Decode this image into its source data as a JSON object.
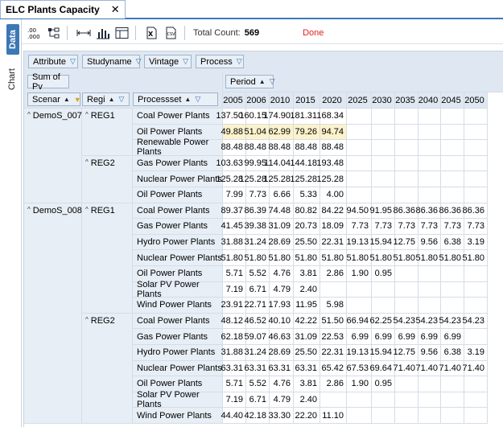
{
  "document_tab": {
    "title": "ELC Plants Capacity",
    "close": "✕"
  },
  "side_tabs": [
    {
      "label": "Data",
      "active": true
    },
    {
      "label": "Chart",
      "active": false
    }
  ],
  "toolbar": {
    "icons": [
      ".00 .000 decimals",
      "hierarchy",
      "width",
      "bar-chart",
      "table",
      "excel-export",
      "csv-export"
    ],
    "count_label": "Total Count:",
    "count_value": "569",
    "status": "Done"
  },
  "filter_fields": [
    "Attribute",
    "Studyname",
    "Vintage",
    "Process"
  ],
  "data_field": "Sum of Pv",
  "column_field": "Period",
  "row_fields": [
    "Scenar",
    "Regi",
    "Processset"
  ],
  "columns": [
    "2005",
    "2006",
    "2010",
    "2015",
    "2020",
    "2025",
    "2030",
    "2035",
    "2040",
    "2045",
    "2050"
  ],
  "rows": [
    {
      "scenario": "DemoS_007",
      "region": "REG1",
      "process": "Coal Power Plants",
      "values": [
        "137.50",
        "160.15",
        "174.90",
        "181.31",
        "168.34",
        "",
        "",
        "",
        "",
        "",
        ""
      ]
    },
    {
      "scenario": "",
      "region": "",
      "process": "Oil Power Plants",
      "highlight": true,
      "values": [
        "49.88",
        "51.04",
        "62.99",
        "79.26",
        "94.74",
        "",
        "",
        "",
        "",
        "",
        ""
      ]
    },
    {
      "scenario": "",
      "region": "",
      "process": "Renewable Power Plants",
      "values": [
        "88.48",
        "88.48",
        "88.48",
        "88.48",
        "88.48",
        "",
        "",
        "",
        "",
        "",
        ""
      ]
    },
    {
      "scenario": "",
      "region": "REG2",
      "process": "Gas Power Plants",
      "values": [
        "103.63",
        "99.95",
        "114.04",
        "144.18",
        "193.48",
        "",
        "",
        "",
        "",
        "",
        ""
      ]
    },
    {
      "scenario": "",
      "region": "",
      "process": "Nuclear Power Plants",
      "values": [
        "125.28",
        "125.28",
        "125.28",
        "125.28",
        "125.28",
        "",
        "",
        "",
        "",
        "",
        ""
      ]
    },
    {
      "scenario": "",
      "region": "",
      "process": "Oil Power Plants",
      "values": [
        "7.99",
        "7.73",
        "6.66",
        "5.33",
        "4.00",
        "",
        "",
        "",
        "",
        "",
        ""
      ]
    },
    {
      "scenario": "DemoS_008",
      "region": "REG1",
      "process": "Coal Power Plants",
      "values": [
        "89.37",
        "86.39",
        "74.48",
        "80.82",
        "84.22",
        "94.50",
        "91.95",
        "86.36",
        "86.36",
        "86.36",
        "86.36"
      ]
    },
    {
      "scenario": "",
      "region": "",
      "process": "Gas Power Plants",
      "values": [
        "41.45",
        "39.38",
        "31.09",
        "20.73",
        "18.09",
        "7.73",
        "7.73",
        "7.73",
        "7.73",
        "7.73",
        "7.73"
      ]
    },
    {
      "scenario": "",
      "region": "",
      "process": "Hydro Power Plants",
      "values": [
        "31.88",
        "31.24",
        "28.69",
        "25.50",
        "22.31",
        "19.13",
        "15.94",
        "12.75",
        "9.56",
        "6.38",
        "3.19"
      ]
    },
    {
      "scenario": "",
      "region": "",
      "process": "Nuclear Power Plants",
      "values": [
        "51.80",
        "51.80",
        "51.80",
        "51.80",
        "51.80",
        "51.80",
        "51.80",
        "51.80",
        "51.80",
        "51.80",
        "51.80"
      ]
    },
    {
      "scenario": "",
      "region": "",
      "process": "Oil Power Plants",
      "values": [
        "5.71",
        "5.52",
        "4.76",
        "3.81",
        "2.86",
        "1.90",
        "0.95",
        "",
        "",
        "",
        ""
      ]
    },
    {
      "scenario": "",
      "region": "",
      "process": "Solar PV Power Plants",
      "values": [
        "7.19",
        "6.71",
        "4.79",
        "2.40",
        "",
        "",
        "",
        "",
        "",
        "",
        ""
      ]
    },
    {
      "scenario": "",
      "region": "",
      "process": "Wind Power Plants",
      "values": [
        "23.91",
        "22.71",
        "17.93",
        "11.95",
        "5.98",
        "",
        "",
        "",
        "",
        "",
        ""
      ]
    },
    {
      "scenario": "",
      "region": "REG2",
      "process": "Coal Power Plants",
      "values": [
        "48.12",
        "46.52",
        "40.10",
        "42.22",
        "51.50",
        "66.94",
        "62.25",
        "54.23",
        "54.23",
        "54.23",
        "54.23"
      ]
    },
    {
      "scenario": "",
      "region": "",
      "process": "Gas Power Plants",
      "values": [
        "62.18",
        "59.07",
        "46.63",
        "31.09",
        "22.53",
        "6.99",
        "6.99",
        "6.99",
        "6.99",
        "6.99",
        ""
      ]
    },
    {
      "scenario": "",
      "region": "",
      "process": "Hydro Power Plants",
      "values": [
        "31.88",
        "31.24",
        "28.69",
        "25.50",
        "22.31",
        "19.13",
        "15.94",
        "12.75",
        "9.56",
        "6.38",
        "3.19"
      ]
    },
    {
      "scenario": "",
      "region": "",
      "process": "Nuclear Power Plants",
      "values": [
        "63.31",
        "63.31",
        "63.31",
        "63.31",
        "65.42",
        "67.53",
        "69.64",
        "71.40",
        "71.40",
        "71.40",
        "71.40"
      ]
    },
    {
      "scenario": "",
      "region": "",
      "process": "Oil Power Plants",
      "values": [
        "5.71",
        "5.52",
        "4.76",
        "3.81",
        "2.86",
        "1.90",
        "0.95",
        "",
        "",
        "",
        ""
      ]
    },
    {
      "scenario": "",
      "region": "",
      "process": "Solar PV Power Plants",
      "values": [
        "7.19",
        "6.71",
        "4.79",
        "2.40",
        "",
        "",
        "",
        "",
        "",
        "",
        ""
      ]
    },
    {
      "scenario": "",
      "region": "",
      "process": "Wind Power Plants",
      "values": [
        "44.40",
        "42.18",
        "33.30",
        "22.20",
        "11.10",
        "",
        "",
        "",
        "",
        "",
        ""
      ]
    }
  ]
}
